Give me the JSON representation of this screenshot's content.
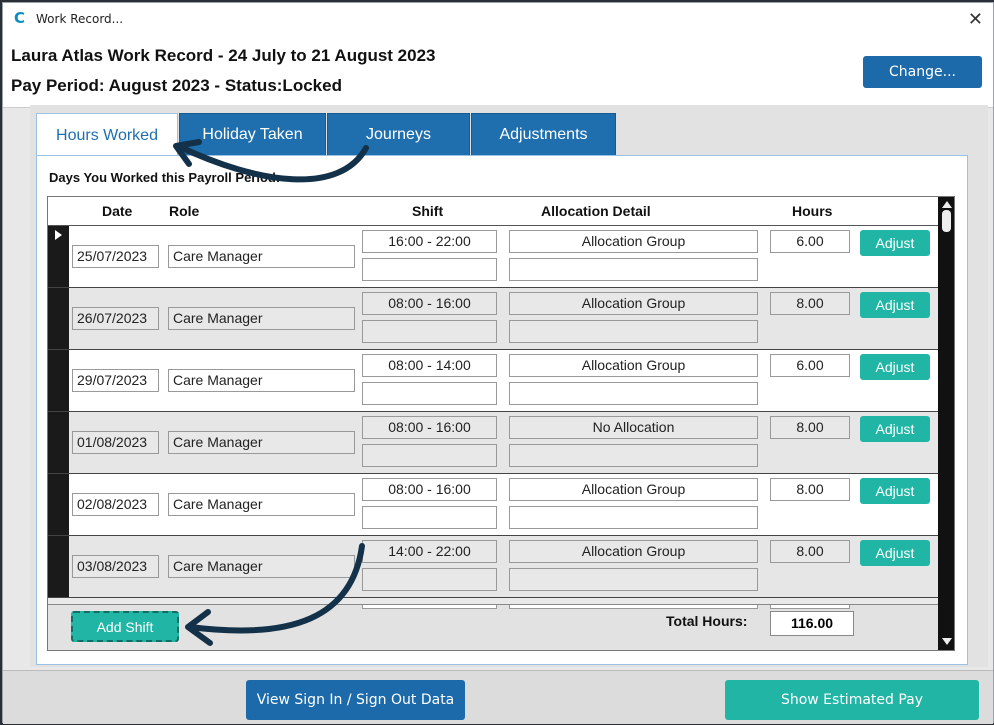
{
  "window": {
    "title": "Work Record..."
  },
  "header": {
    "line1": "Laura Atlas Work Record - 24 July to 21 August 2023",
    "line2": "Pay Period: August 2023 - Status:Locked",
    "change_label": "Change..."
  },
  "tabs": [
    {
      "label": "Hours Worked",
      "active": true
    },
    {
      "label": "Holiday Taken",
      "active": false
    },
    {
      "label": "Journeys",
      "active": false
    },
    {
      "label": "Adjustments",
      "active": false
    }
  ],
  "section_label": "Days You Worked this Payroll Period:",
  "columns": {
    "date": "Date",
    "role": "Role",
    "shift": "Shift",
    "allocation": "Allocation Detail",
    "hours": "Hours"
  },
  "rows": [
    {
      "date": "25/07/2023",
      "role": "Care Manager",
      "shift": "16:00 - 22:00",
      "allocation": "Allocation Group",
      "hours": "6.00",
      "action": "Adjust",
      "shaded": false
    },
    {
      "date": "26/07/2023",
      "role": "Care Manager",
      "shift": "08:00 - 16:00",
      "allocation": "Allocation Group",
      "hours": "8.00",
      "action": "Adjust",
      "shaded": true
    },
    {
      "date": "29/07/2023",
      "role": "Care Manager",
      "shift": "08:00 - 14:00",
      "allocation": "Allocation Group",
      "hours": "6.00",
      "action": "Adjust",
      "shaded": false
    },
    {
      "date": "01/08/2023",
      "role": "Care Manager",
      "shift": "08:00 - 16:00",
      "allocation": "No Allocation",
      "hours": "8.00",
      "action": "Adjust",
      "shaded": true
    },
    {
      "date": "02/08/2023",
      "role": "Care Manager",
      "shift": "08:00 - 16:00",
      "allocation": "Allocation Group",
      "hours": "8.00",
      "action": "Adjust",
      "shaded": false
    },
    {
      "date": "03/08/2023",
      "role": "Care Manager",
      "shift": "14:00 - 22:00",
      "allocation": "Allocation Group",
      "hours": "8.00",
      "action": "Adjust",
      "shaded": true
    }
  ],
  "footer": {
    "add_shift_label": "Add Shift",
    "total_label": "Total Hours:",
    "total_value": "116.00"
  },
  "bottom": {
    "sign_label": "View Sign In / Sign Out Data",
    "pay_label": "Show Estimated Pay"
  },
  "colors": {
    "primary_blue": "#1d6aab",
    "teal": "#21b5a6",
    "annotation_arrow": "#13324a"
  },
  "icons": {
    "app": "app-logo-icon",
    "close": "close-icon",
    "pointer": "current-row-pointer-icon"
  }
}
